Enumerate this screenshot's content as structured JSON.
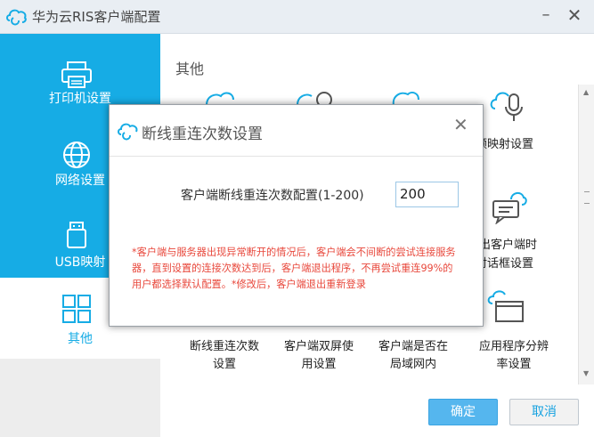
{
  "window": {
    "title": "华为云RIS客户端配置",
    "minimize_symbol": "–",
    "close_symbol": "✕"
  },
  "sidebar": {
    "items": [
      {
        "label": "打印机设置",
        "icon": "printer-icon"
      },
      {
        "label": "网络设置",
        "icon": "globe-icon"
      },
      {
        "label": "USB映射",
        "icon": "usb-icon"
      },
      {
        "label": "其他",
        "icon": "grid-icon",
        "active": true
      }
    ]
  },
  "main": {
    "section_title": "其他",
    "items": [
      {
        "label_line1": "频映射设置",
        "label_line2": "",
        "icon": "microphone-cloud-icon"
      },
      {
        "label_line1": "出客户端时",
        "label_line2": "对话框设置",
        "icon": "chat-cloud-icon"
      },
      {
        "label_line1": "断线重连次数",
        "label_line2": "设置",
        "icon": "reconnect-icon"
      },
      {
        "label_line1": "客户端双屏使",
        "label_line2": "用设置",
        "icon": "dual-screen-icon"
      },
      {
        "label_line1": "客户端是否在",
        "label_line2": "局域网内",
        "icon": "lan-icon"
      },
      {
        "label_line1": "应用程序分辨",
        "label_line2": "率设置",
        "icon": "resolution-window-icon"
      }
    ]
  },
  "buttons": {
    "ok": "确定",
    "cancel": "取消"
  },
  "dialog": {
    "title": "断线重连次数设置",
    "close_symbol": "✕",
    "field_label": "客户端断线重连次数配置(1-200)",
    "field_value": "200",
    "note": "*客户端与服务器出现异常断开的情况后，客户端会不间断的尝试连接服务器，直到设置的连接次数达到后，客户端退出程序，不再尝试重连99%的用户都选择默认配置。*修改后，客户端退出重新登录"
  },
  "colors": {
    "brand": "#16ace5",
    "warning_text": "#e8473b",
    "ok_button": "#55b6ee"
  }
}
